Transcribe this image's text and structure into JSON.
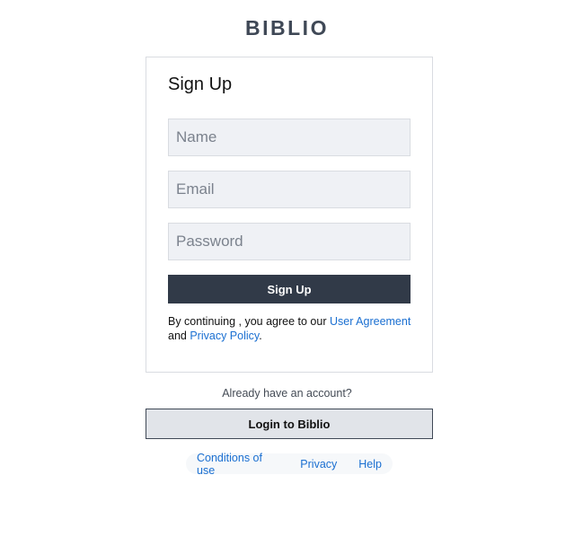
{
  "brand": {
    "logo_text": "BIBLIO"
  },
  "signup_card": {
    "title": "Sign Up",
    "name_placeholder": "Name",
    "email_placeholder": "Email",
    "password_placeholder": "Password",
    "submit_label": "Sign Up",
    "terms": {
      "prefix": "By continuing , you agree to our ",
      "user_agreement_link": "User Agreement",
      "middle": " and ",
      "privacy_policy_link": "Privacy Policy",
      "suffix": "."
    }
  },
  "login": {
    "prompt": "Already have an account?",
    "button_label": "Login to Biblio"
  },
  "footer": {
    "links": [
      "Conditions of use",
      "Privacy",
      "Help"
    ]
  },
  "colors": {
    "primary_button": "#313a48",
    "link": "#1a6fd1",
    "input_background": "#eff1f5"
  }
}
